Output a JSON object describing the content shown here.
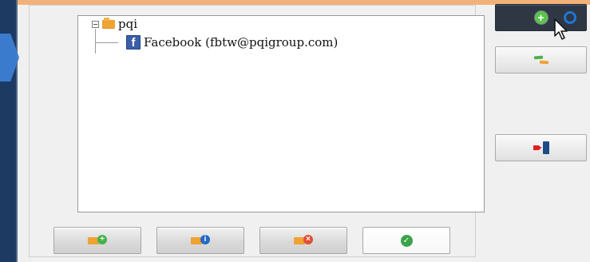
{
  "tree": {
    "root_label": "pqi",
    "child_label": "Facebook (fbtw@pqigroup.com)"
  },
  "icons": {
    "collapse": "collapse-icon",
    "folder": "folder-icon",
    "facebook": "facebook-icon",
    "add": "add-account-icon",
    "sync": "sync-icon",
    "exit": "exit-icon",
    "cursor": "mouse-cursor-icon",
    "ring": "blue-ring-icon"
  },
  "colors": {
    "top_strip": "#f1b27a",
    "left_rail": "#1d3a63",
    "accent_blue": "#3d7ed3",
    "folder": "#f0a232",
    "facebook_blue": "#3b5ea9",
    "dark_button": "#2e3743"
  }
}
